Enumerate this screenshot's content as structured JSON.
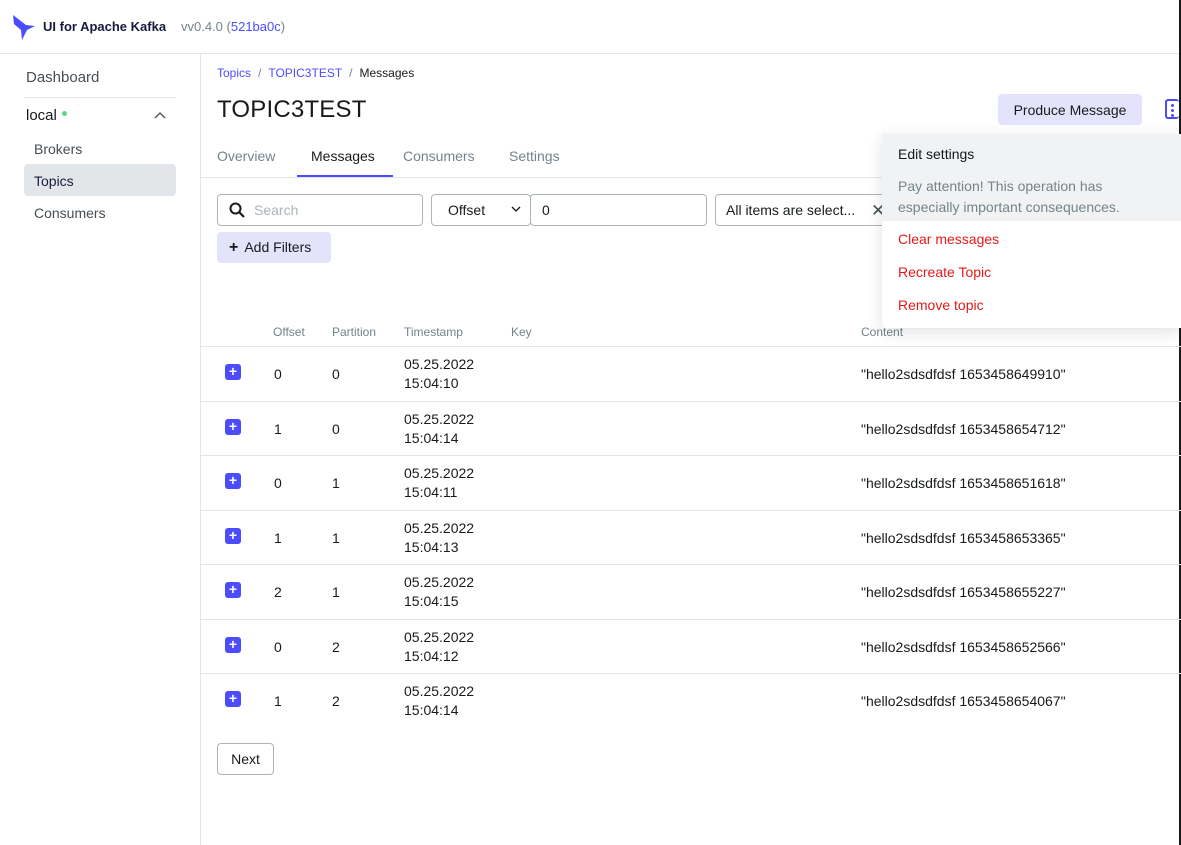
{
  "app": {
    "title": "UI for Apache Kafka",
    "version_prefix": "vv0.4.0 (",
    "commit": "521ba0c",
    "version_suffix": ")",
    "accent_color": "#4c4cff",
    "logo_icon": "kafka-ui-logo"
  },
  "sidebar": {
    "dashboard": "Dashboard",
    "cluster": {
      "name": "local",
      "status": "online",
      "status_color": "#5cd685"
    },
    "items": [
      {
        "label": "Brokers",
        "active": false
      },
      {
        "label": "Topics",
        "active": true
      },
      {
        "label": "Consumers",
        "active": false
      }
    ]
  },
  "breadcrumb": {
    "items": [
      "Topics",
      "TOPIC3TEST"
    ],
    "current": "Messages"
  },
  "page": {
    "title": "TOPIC3TEST",
    "produce_button": "Produce Message",
    "more_icon": "kebab-menu-icon"
  },
  "tabs": [
    "Overview",
    "Messages",
    "Consumers",
    "Settings"
  ],
  "active_tab": "Messages",
  "filters": {
    "search_placeholder": "Search",
    "seek_type": "Offset",
    "seek_value": "0",
    "partitions_label": "All items are select...",
    "add_filters": "Add Filters"
  },
  "table": {
    "headers": [
      "Offset",
      "Partition",
      "Timestamp",
      "Key",
      "Content"
    ],
    "rows": [
      {
        "offset": "0",
        "partition": "0",
        "date": "05.25.2022",
        "time": "15:04:10",
        "key": "",
        "content": "\"hello2sdsdfdsf 1653458649910\""
      },
      {
        "offset": "1",
        "partition": "0",
        "date": "05.25.2022",
        "time": "15:04:14",
        "key": "",
        "content": "\"hello2sdsdfdsf 1653458654712\""
      },
      {
        "offset": "0",
        "partition": "1",
        "date": "05.25.2022",
        "time": "15:04:11",
        "key": "",
        "content": "\"hello2sdsdfdsf 1653458651618\""
      },
      {
        "offset": "1",
        "partition": "1",
        "date": "05.25.2022",
        "time": "15:04:13",
        "key": "",
        "content": "\"hello2sdsdfdsf 1653458653365\""
      },
      {
        "offset": "2",
        "partition": "1",
        "date": "05.25.2022",
        "time": "15:04:15",
        "key": "",
        "content": "\"hello2sdsdfdsf 1653458655227\""
      },
      {
        "offset": "0",
        "partition": "2",
        "date": "05.25.2022",
        "time": "15:04:12",
        "key": "",
        "content": "\"hello2sdsdfdsf 1653458652566\""
      },
      {
        "offset": "1",
        "partition": "2",
        "date": "05.25.2022",
        "time": "15:04:14",
        "key": "",
        "content": "\"hello2sdsdfdsf 1653458654067\""
      }
    ]
  },
  "pagination": {
    "next": "Next"
  },
  "dropdown": {
    "edit_settings": "Edit settings",
    "warning": "Pay attention! This operation has especially important consequences.",
    "items": [
      "Clear messages",
      "Recreate Topic",
      "Remove topic"
    ],
    "danger_color": "#e51a1a"
  }
}
